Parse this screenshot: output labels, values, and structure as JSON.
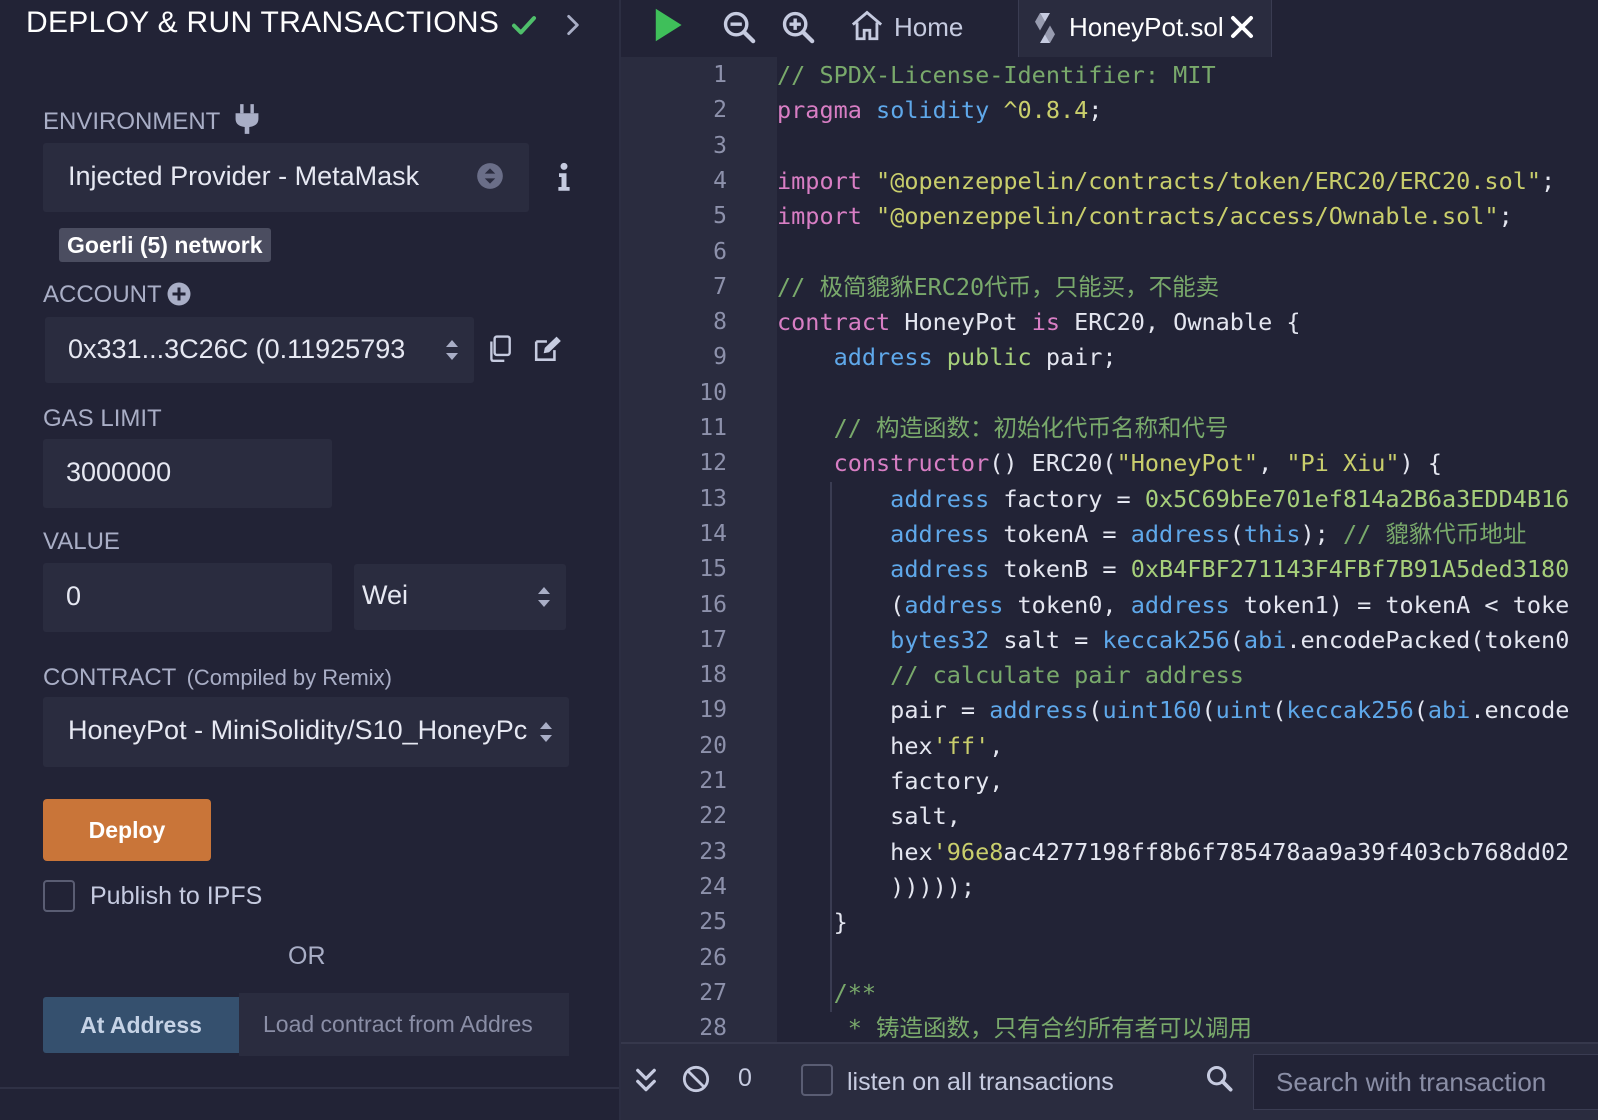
{
  "panel": {
    "title": "DEPLOY & RUN TRANSACTIONS",
    "environment_label": "ENVIRONMENT",
    "environment_value": "Injected Provider - MetaMask",
    "network_badge": "Goerli (5) network",
    "account_label": "ACCOUNT",
    "account_value": "0x331...3C26C (0.11925793",
    "gas_limit_label": "GAS LIMIT",
    "gas_limit_value": "3000000",
    "value_label": "VALUE",
    "value_amount": "0",
    "value_unit": "Wei",
    "contract_label": "CONTRACT",
    "contract_sublabel": "(Compiled by Remix)",
    "contract_value": "HoneyPot - MiniSolidity/S10_HoneyPc",
    "deploy_label": "Deploy",
    "publish_label": "Publish to IPFS",
    "or_label": "OR",
    "at_address_label": "At Address",
    "load_contract_placeholder": "Load contract from Addres"
  },
  "editor": {
    "tabs": [
      {
        "label": "Home",
        "icon": "home-icon"
      },
      {
        "label": "HoneyPot.sol",
        "icon": "solidity-icon"
      }
    ],
    "line_numbers": [
      "1",
      "2",
      "3",
      "4",
      "5",
      "6",
      "7",
      "8",
      "9",
      "10",
      "11",
      "12",
      "13",
      "14",
      "15",
      "16",
      "17",
      "18",
      "19",
      "20",
      "21",
      "22",
      "23",
      "24",
      "25",
      "26",
      "27",
      "28"
    ],
    "code": [
      [
        {
          "t": "// SPDX-License-Identifier: MIT",
          "c": "cm"
        }
      ],
      [
        {
          "t": "pragma ",
          "c": "kw"
        },
        {
          "t": "solidity ",
          "c": "ty"
        },
        {
          "t": "^0.8.4",
          "c": "st"
        },
        {
          "t": ";",
          "c": "id"
        }
      ],
      [],
      [
        {
          "t": "import ",
          "c": "kw"
        },
        {
          "t": "\"@openzeppelin/contracts/token/ERC20/ERC20.sol\"",
          "c": "st"
        },
        {
          "t": ";",
          "c": "id"
        }
      ],
      [
        {
          "t": "import ",
          "c": "kw"
        },
        {
          "t": "\"@openzeppelin/contracts/access/Ownable.sol\"",
          "c": "st"
        },
        {
          "t": ";",
          "c": "id"
        }
      ],
      [],
      [
        {
          "t": "// 极简貔貅ERC20代币，只能买，不能卖",
          "c": "cm"
        }
      ],
      [
        {
          "t": "contract ",
          "c": "kw"
        },
        {
          "t": "HoneyPot ",
          "c": "id"
        },
        {
          "t": "is ",
          "c": "kw"
        },
        {
          "t": "ERC20, Ownable {",
          "c": "id"
        }
      ],
      [
        {
          "t": "    address ",
          "c": "ty"
        },
        {
          "t": "public ",
          "c": "nm"
        },
        {
          "t": "pair;",
          "c": "id"
        }
      ],
      [],
      [
        {
          "t": "    // 构造函数：初始化代币名称和代号",
          "c": "cm"
        }
      ],
      [
        {
          "t": "    constructor",
          "c": "kw"
        },
        {
          "t": "() ERC20(",
          "c": "id"
        },
        {
          "t": "\"HoneyPot\"",
          "c": "st"
        },
        {
          "t": ", ",
          "c": "id"
        },
        {
          "t": "\"Pi Xiu\"",
          "c": "st"
        },
        {
          "t": ") {",
          "c": "id"
        }
      ],
      [
        {
          "t": "        address ",
          "c": "ty"
        },
        {
          "t": "factory = ",
          "c": "id"
        },
        {
          "t": "0x5C69bEe701ef814a2B6a3EDD4B16",
          "c": "nm"
        }
      ],
      [
        {
          "t": "        address ",
          "c": "ty"
        },
        {
          "t": "tokenA = ",
          "c": "id"
        },
        {
          "t": "address",
          "c": "ty"
        },
        {
          "t": "(",
          "c": "id"
        },
        {
          "t": "this",
          "c": "ty"
        },
        {
          "t": "); ",
          "c": "id"
        },
        {
          "t": "// 貔貅代币地址",
          "c": "cm"
        }
      ],
      [
        {
          "t": "        address ",
          "c": "ty"
        },
        {
          "t": "tokenB = ",
          "c": "id"
        },
        {
          "t": "0xB4FBF271143F4FBf7B91A5ded3180",
          "c": "nm"
        }
      ],
      [
        {
          "t": "        (",
          "c": "id"
        },
        {
          "t": "address ",
          "c": "ty"
        },
        {
          "t": "token0, ",
          "c": "id"
        },
        {
          "t": "address ",
          "c": "ty"
        },
        {
          "t": "token1) = tokenA < toke",
          "c": "id"
        }
      ],
      [
        {
          "t": "        bytes32 ",
          "c": "ty"
        },
        {
          "t": "salt = ",
          "c": "id"
        },
        {
          "t": "keccak256",
          "c": "ty"
        },
        {
          "t": "(",
          "c": "id"
        },
        {
          "t": "abi",
          "c": "ty"
        },
        {
          "t": ".encodePacked(token0",
          "c": "id"
        }
      ],
      [
        {
          "t": "        // calculate pair address",
          "c": "cm"
        }
      ],
      [
        {
          "t": "        pair = ",
          "c": "id"
        },
        {
          "t": "address",
          "c": "ty"
        },
        {
          "t": "(",
          "c": "id"
        },
        {
          "t": "uint160",
          "c": "ty"
        },
        {
          "t": "(",
          "c": "id"
        },
        {
          "t": "uint",
          "c": "ty"
        },
        {
          "t": "(",
          "c": "id"
        },
        {
          "t": "keccak256",
          "c": "ty"
        },
        {
          "t": "(",
          "c": "id"
        },
        {
          "t": "abi",
          "c": "ty"
        },
        {
          "t": ".encode",
          "c": "id"
        }
      ],
      [
        {
          "t": "        hex",
          "c": "id"
        },
        {
          "t": "'ff'",
          "c": "st"
        },
        {
          "t": ",",
          "c": "id"
        }
      ],
      [
        {
          "t": "        factory,",
          "c": "id"
        }
      ],
      [
        {
          "t": "        salt,",
          "c": "id"
        }
      ],
      [
        {
          "t": "        hex",
          "c": "id"
        },
        {
          "t": "'96e8",
          "c": "st"
        },
        {
          "t": "ac4277198ff8b6f785478aa9a39f403cb768dd02",
          "c": "id"
        }
      ],
      [
        {
          "t": "        )))));",
          "c": "id"
        }
      ],
      [
        {
          "t": "    }",
          "c": "id"
        }
      ],
      [],
      [
        {
          "t": "    /**",
          "c": "cm"
        }
      ],
      [
        {
          "t": "     * 铸造函数，只有合约所有者可以调用",
          "c": "cm"
        }
      ]
    ]
  },
  "terminal": {
    "count": "0",
    "listen_label": "listen on all transactions",
    "search_placeholder": "Search with transaction"
  },
  "colors": {
    "background": "#222336",
    "panel_box": "#2a2c3f",
    "deploy_button": "#c97539",
    "at_address_button": "#35506e",
    "check_green": "#4fbf6b",
    "run_green": "#3fbf5a"
  }
}
